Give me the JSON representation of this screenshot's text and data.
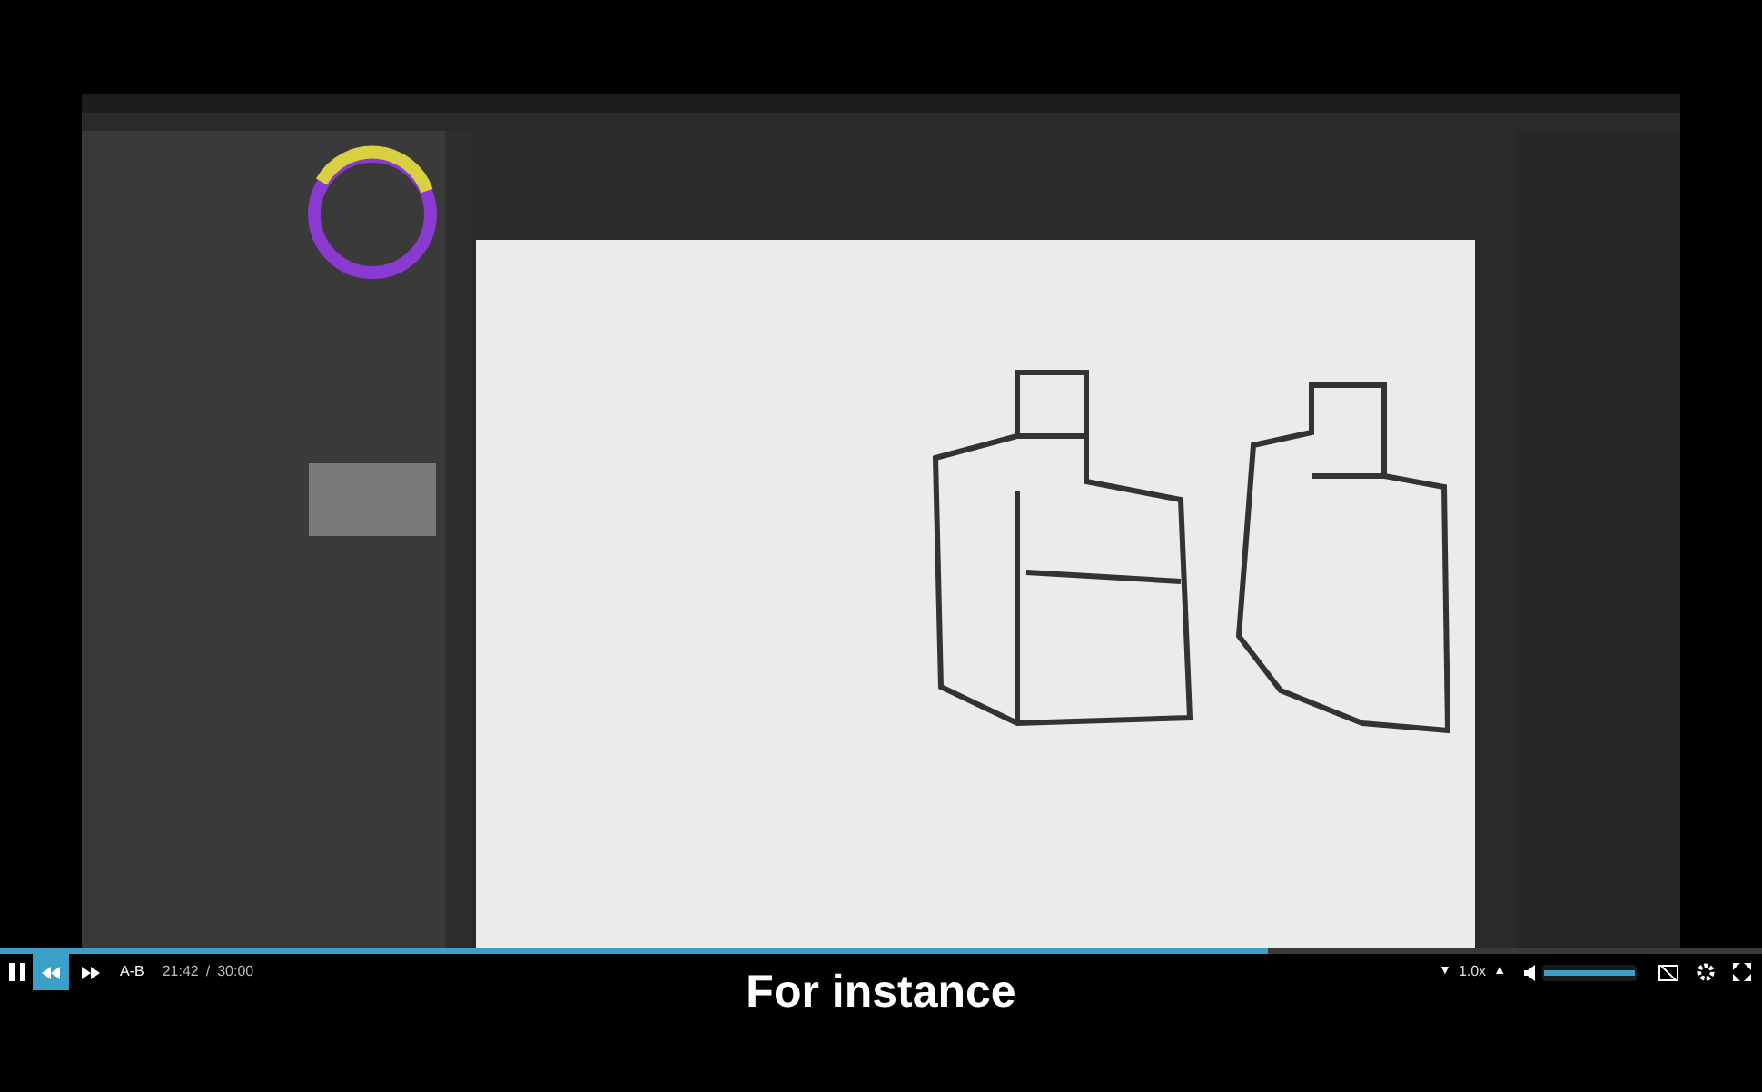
{
  "progress": {
    "level": 0.72
  },
  "controls": {
    "rewind": {
      "active": true
    },
    "ab_loop": "A-B",
    "current_time": "21:42",
    "separator": "/",
    "total_time": "30:00"
  },
  "speed": {
    "down": "▼",
    "value": "1.0x",
    "up": "▲"
  },
  "volume": {
    "level": 1.0
  },
  "subtitle": "For instance"
}
